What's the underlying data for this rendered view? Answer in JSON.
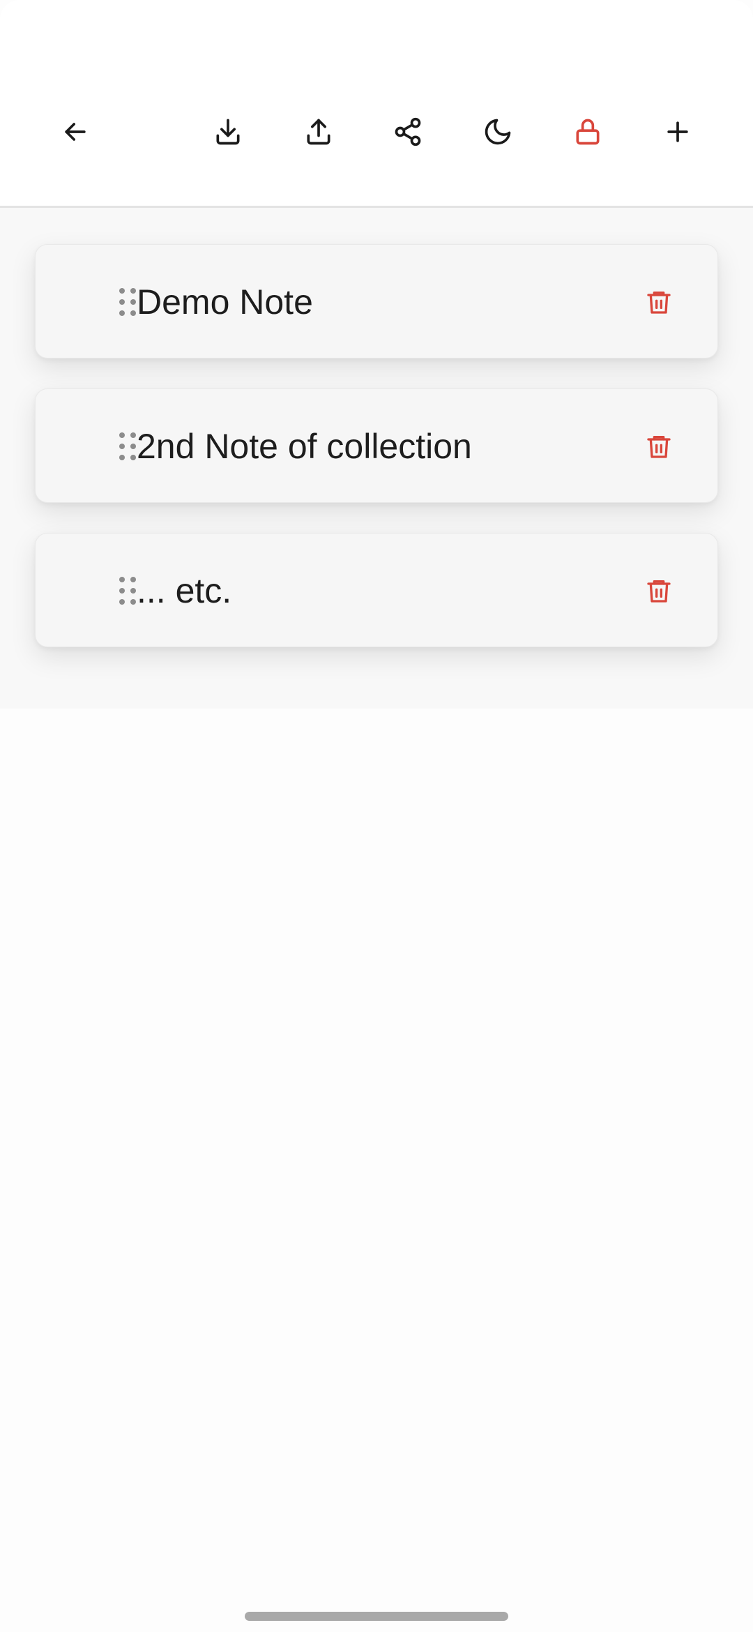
{
  "toolbar": {
    "back_icon": "arrow-left-icon",
    "download_icon": "download-icon",
    "upload_icon": "upload-icon",
    "share_icon": "share-icon",
    "theme_icon": "moon-icon",
    "lock_icon": "lock-icon",
    "add_icon": "plus-icon"
  },
  "colors": {
    "icon_default": "#1a1a1a",
    "accent_red": "#d9463b",
    "handle_gray": "#8c8c8c",
    "text": "#1d1d1d"
  },
  "notes": [
    {
      "title": "Demo Note"
    },
    {
      "title": "2nd Note of collection"
    },
    {
      "title": "... etc."
    }
  ]
}
